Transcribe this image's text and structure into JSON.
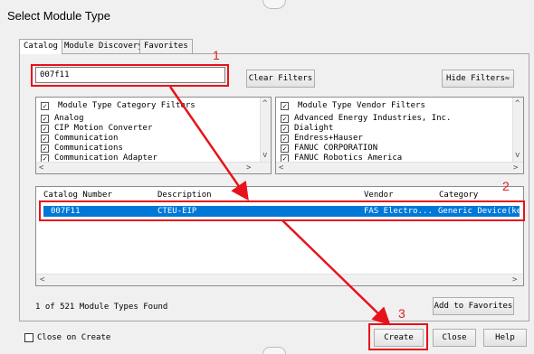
{
  "dialog": {
    "title": "Select Module Type"
  },
  "tabs": [
    {
      "label": "Catalog",
      "active": true
    },
    {
      "label": "Module Discovery",
      "active": false
    },
    {
      "label": "Favorites",
      "active": false
    }
  ],
  "search": {
    "value": "007f11"
  },
  "buttons": {
    "clear_filters": "Clear Filters",
    "hide_filters": "Hide Filters",
    "add_favorites": "Add to Favorites",
    "create": "Create",
    "close": "Close",
    "help": "Help"
  },
  "category_filters": {
    "header": "Module Type Category Filters",
    "items": [
      "Analog",
      "CIP Motion Converter",
      "Communication",
      "Communications",
      "Communication Adapter"
    ]
  },
  "vendor_filters": {
    "header": "Module Type Vendor Filters",
    "items": [
      "Advanced Energy Industries, Inc.",
      "Dialight",
      "Endress+Hauser",
      "FANUC CORPORATION",
      "FANUC Robotics America"
    ]
  },
  "table": {
    "columns": [
      "Catalog Number",
      "Description",
      "Vendor",
      "Category"
    ],
    "rows": [
      {
        "catalog": "007F11",
        "description": "CTEU-EIP",
        "vendor": "FAS Electro...",
        "category": "Generic Device(ke"
      }
    ]
  },
  "status": {
    "found": "1 of 521 Module Types Found"
  },
  "options": {
    "close_on_create": "Close on Create"
  },
  "annotations": {
    "one": "1",
    "two": "2",
    "three": "3"
  },
  "colors": {
    "selection": "#0078d7",
    "annotation": "#e8121a"
  }
}
